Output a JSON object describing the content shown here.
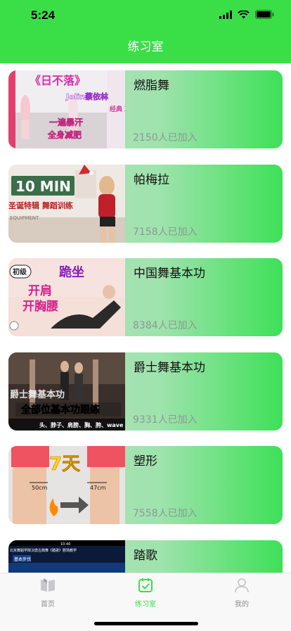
{
  "status_bar": {
    "time": "5:24"
  },
  "nav": {
    "title": "练习室"
  },
  "thumbs": [
    {
      "main": "《日不落》",
      "sub": "Jolin蔡依林",
      "tag1": "一遍暴汗",
      "tag2": "全身减肥",
      "side": "经典\n减肥"
    },
    {
      "main": "10 MIN",
      "sub": "圣诞特辑 舞蹈训练",
      "small": "EQUIPMENT"
    },
    {
      "badge": "初级",
      "main": "跪坐",
      "line1": "开肩",
      "line2": "开胸腰"
    },
    {
      "main": "爵士舞基本功",
      "line1": "全部位基本功跟练",
      "line2": "头、脖子、肩膀、胸、胯、wave"
    },
    {
      "main": "7天",
      "left": "50cm",
      "right": "47cm"
    },
    {
      "top": "10:40",
      "caption": "北京舞蹈学院汉唐古典舞《踏歌》剧场教学",
      "label": "基本步伐"
    }
  ],
  "courses": [
    {
      "title": "燃脂舞",
      "count": "2150人已加入"
    },
    {
      "title": "帕梅拉",
      "count": "7158人已加入"
    },
    {
      "title": "中国舞基本功",
      "count": "8384人已加入"
    },
    {
      "title": "爵士舞基本功",
      "count": "9331人已加入"
    },
    {
      "title": "塑形",
      "count": "7558人已加入"
    },
    {
      "title": "踏歌",
      "count": ""
    }
  ],
  "tabbar": {
    "items": [
      {
        "label": "首页",
        "icon": "home-book-icon",
        "active": false
      },
      {
        "label": "练习室",
        "icon": "practice-check-icon",
        "active": true
      },
      {
        "label": "我的",
        "icon": "person-icon",
        "active": false
      }
    ],
    "active_color": "#3adf48",
    "inactive_color": "#8e8e93"
  }
}
